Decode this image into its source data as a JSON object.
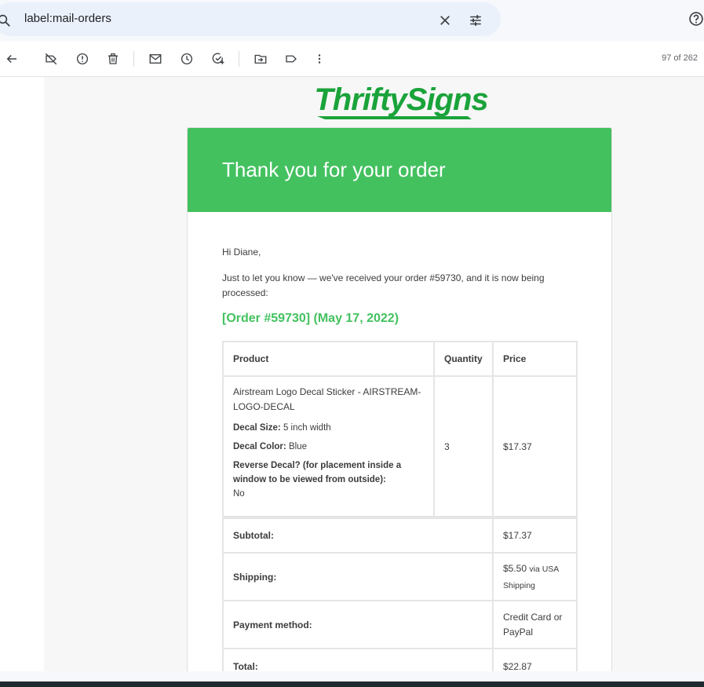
{
  "search": {
    "query": "label:mail-orders"
  },
  "toolbar": {
    "count": "97 of 262"
  },
  "logo": {
    "text": "ThriftySigns"
  },
  "email": {
    "header_title": "Thank you for your order",
    "greeting": "Hi Diane,",
    "intro": "Just to let you know — we've received your order #59730, and it is now being processed:",
    "order_title": "[Order #59730] (May 17, 2022)",
    "table": {
      "headers": [
        "Product",
        "Quantity",
        "Price"
      ],
      "item": {
        "name": "Airstream Logo Decal Sticker - AIRSTREAM-LOGO-DECAL",
        "size_label": "Decal Size:",
        "size_value": "5 inch width",
        "color_label": "Decal Color:",
        "color_value": "Blue",
        "reverse_label": "Reverse Decal? (for placement inside a window to be viewed from outside):",
        "reverse_value": "No",
        "quantity": "3",
        "price": "$17.37"
      },
      "totals": [
        {
          "label": "Subtotal:",
          "value": "$17.37",
          "note": ""
        },
        {
          "label": "Shipping:",
          "value": "$5.50",
          "note": "via USA Shipping"
        },
        {
          "label": "Payment method:",
          "value": "Credit Card or PayPal",
          "note": ""
        },
        {
          "label": "Total:",
          "value": "$22.87",
          "note": ""
        }
      ]
    }
  },
  "colors": {
    "brand_green": "#43c15f",
    "logo_green": "#1aa33a"
  }
}
